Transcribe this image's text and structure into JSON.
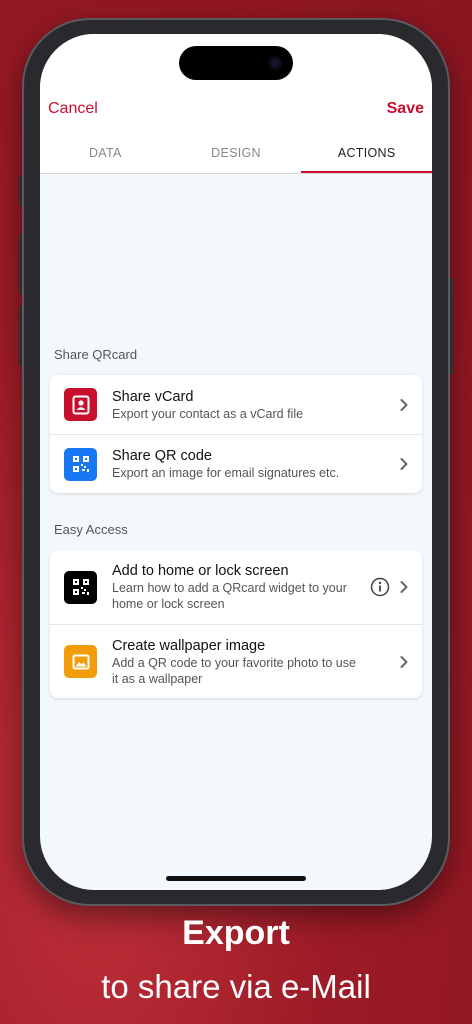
{
  "nav": {
    "cancel_label": "Cancel",
    "save_label": "Save"
  },
  "tabs": [
    {
      "label": "DATA",
      "active": false
    },
    {
      "label": "DESIGN",
      "active": false
    },
    {
      "label": "ACTIONS",
      "active": true
    }
  ],
  "sections": [
    {
      "label": "Share QRcard",
      "items": [
        {
          "title": "Share vCard",
          "subtitle": "Export your contact as a vCard file",
          "icon": "contact-card-icon",
          "icon_color": "#c8102e"
        },
        {
          "title": "Share QR code",
          "subtitle": "Export an image for email signatures etc.",
          "icon": "qr-code-icon",
          "icon_color": "#1877f2"
        }
      ]
    },
    {
      "label": "Easy Access",
      "items": [
        {
          "title": "Add to home or lock screen",
          "subtitle": "Learn how to add a QRcard widget to your home or lock screen",
          "icon": "qr-code-icon",
          "icon_color": "#000000",
          "info_icon": "info-icon"
        },
        {
          "title": "Create wallpaper image",
          "subtitle": "Add a QR code to your favorite photo to use it as a wallpaper",
          "icon": "image-icon",
          "icon_color": "#f39c0a"
        }
      ]
    }
  ],
  "caption": {
    "title": "Export",
    "subtitle": "to share via e-Mail"
  },
  "colors": {
    "accent": "#c8102e",
    "background": "#9c1b26"
  }
}
